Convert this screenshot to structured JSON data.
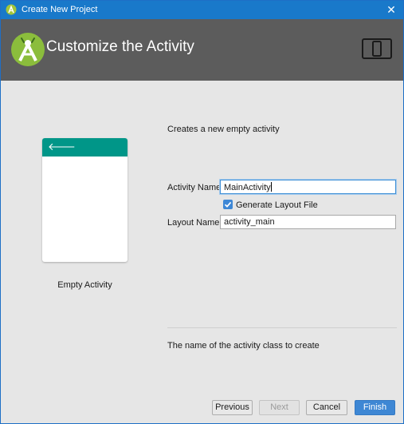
{
  "window": {
    "title": "Create New Project",
    "close_glyph": "✕"
  },
  "header": {
    "title": "Customize the Activity",
    "logo_icon": "android-studio-logo-icon",
    "device_icon": "tablet-phone-icon"
  },
  "preview": {
    "caption": "Empty Activity",
    "back_glyph": "🡐",
    "appbar_color": "#009688"
  },
  "form": {
    "description": "Creates a new empty activity",
    "activity_name_label": "Activity Name:",
    "activity_name_value": "MainActivity",
    "generate_layout_label": "Generate Layout File",
    "generate_layout_checked": true,
    "layout_name_label": "Layout Name:",
    "layout_name_value": "activity_main"
  },
  "hint": "The name of the activity class to create",
  "buttons": {
    "previous": "Previous",
    "next": "Next",
    "cancel": "Cancel",
    "finish": "Finish"
  },
  "colors": {
    "titlebar": "#1979ca",
    "header": "#5c5c5c",
    "accent": "#3e87d4"
  }
}
